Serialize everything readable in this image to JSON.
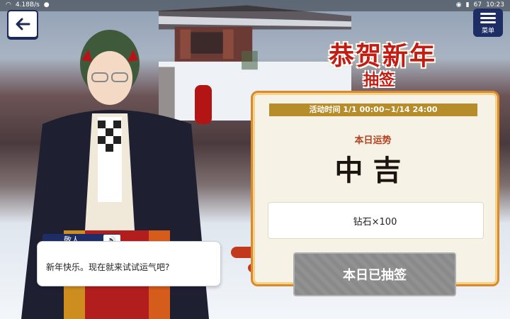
{
  "status_bar": {
    "left_text": "4.18B/s",
    "time": "10:23",
    "battery": "67"
  },
  "nav": {
    "back_icon": "arrow-left-icon",
    "menu_label": "菜单"
  },
  "event": {
    "title": "恭贺新年",
    "subtitle": "抽签",
    "period": "活动时间 1/1 00:00~1/14 24:00"
  },
  "fortune": {
    "label": "本日运势",
    "value": "中吉"
  },
  "reward": {
    "text": "钻石×100"
  },
  "draw_button": {
    "label": "本日已抽签"
  },
  "dialog": {
    "speaker": "敬人",
    "text": "新年快乐。现在就来试试运气吧?"
  },
  "colors": {
    "navy": "#1e2d63",
    "accent_red": "#c21d12",
    "panel_border": "#d9892e",
    "period_bar": "#b68d2a"
  }
}
